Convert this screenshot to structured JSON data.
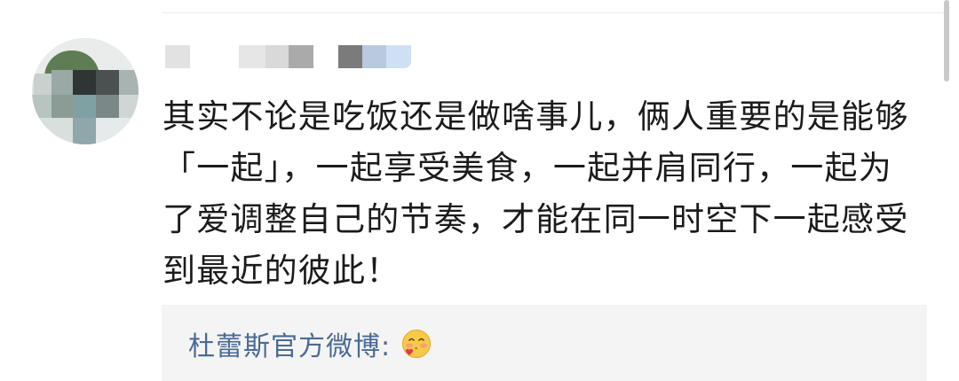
{
  "comment": {
    "text": "其实不论是吃饭还是做啥事儿，俩人重要的是能够「一起」，一起享受美食，一起并肩同行，一起为了爱调整自己的节奏，才能在同一时空下一起感受到最近的彼此！"
  },
  "reply": {
    "author": "杜蕾斯官方微博:",
    "emoji_icon": "blushing-kiss-emoji"
  },
  "colors": {
    "reply_author": "#4a6a94",
    "reply_background": "#f4f4f4",
    "comment_text": "#1b1b1b"
  }
}
